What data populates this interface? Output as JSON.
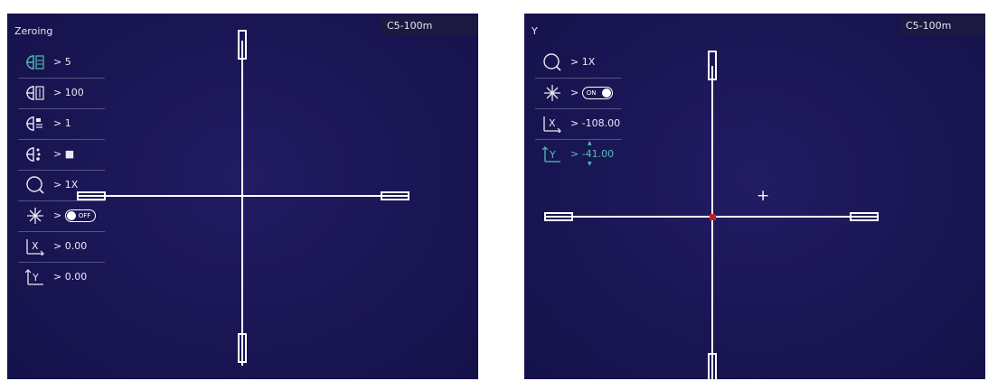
{
  "left_screen": {
    "title": "Zeroing",
    "profile": "C5-100m",
    "menu": [
      {
        "icon": "zeroing-target-icon",
        "value": "> 5"
      },
      {
        "icon": "distance-icon",
        "value": "> 100"
      },
      {
        "icon": "reticle-style-icon",
        "value": "> 1"
      },
      {
        "icon": "reticle-color-icon",
        "value": "> ■"
      },
      {
        "icon": "zoom-icon",
        "value": "> 1X"
      },
      {
        "icon": "freeze-icon",
        "value": ">",
        "toggle": "OFF"
      },
      {
        "icon": "x-axis-icon",
        "value": "> 0.00"
      },
      {
        "icon": "y-axis-icon",
        "value": "> 0.00"
      }
    ]
  },
  "right_screen": {
    "title": "Y",
    "profile": "C5-100m",
    "menu": [
      {
        "icon": "zoom-icon",
        "value": "> 1X"
      },
      {
        "icon": "freeze-icon",
        "value": ">",
        "toggle": "ON"
      },
      {
        "icon": "x-axis-icon",
        "value": "> -108.00"
      },
      {
        "icon": "y-axis-icon",
        "value": "> -41.00"
      }
    ],
    "cursor": "+",
    "center_marker_color": "#c0202a"
  },
  "accent_color": "#4fc2b8"
}
